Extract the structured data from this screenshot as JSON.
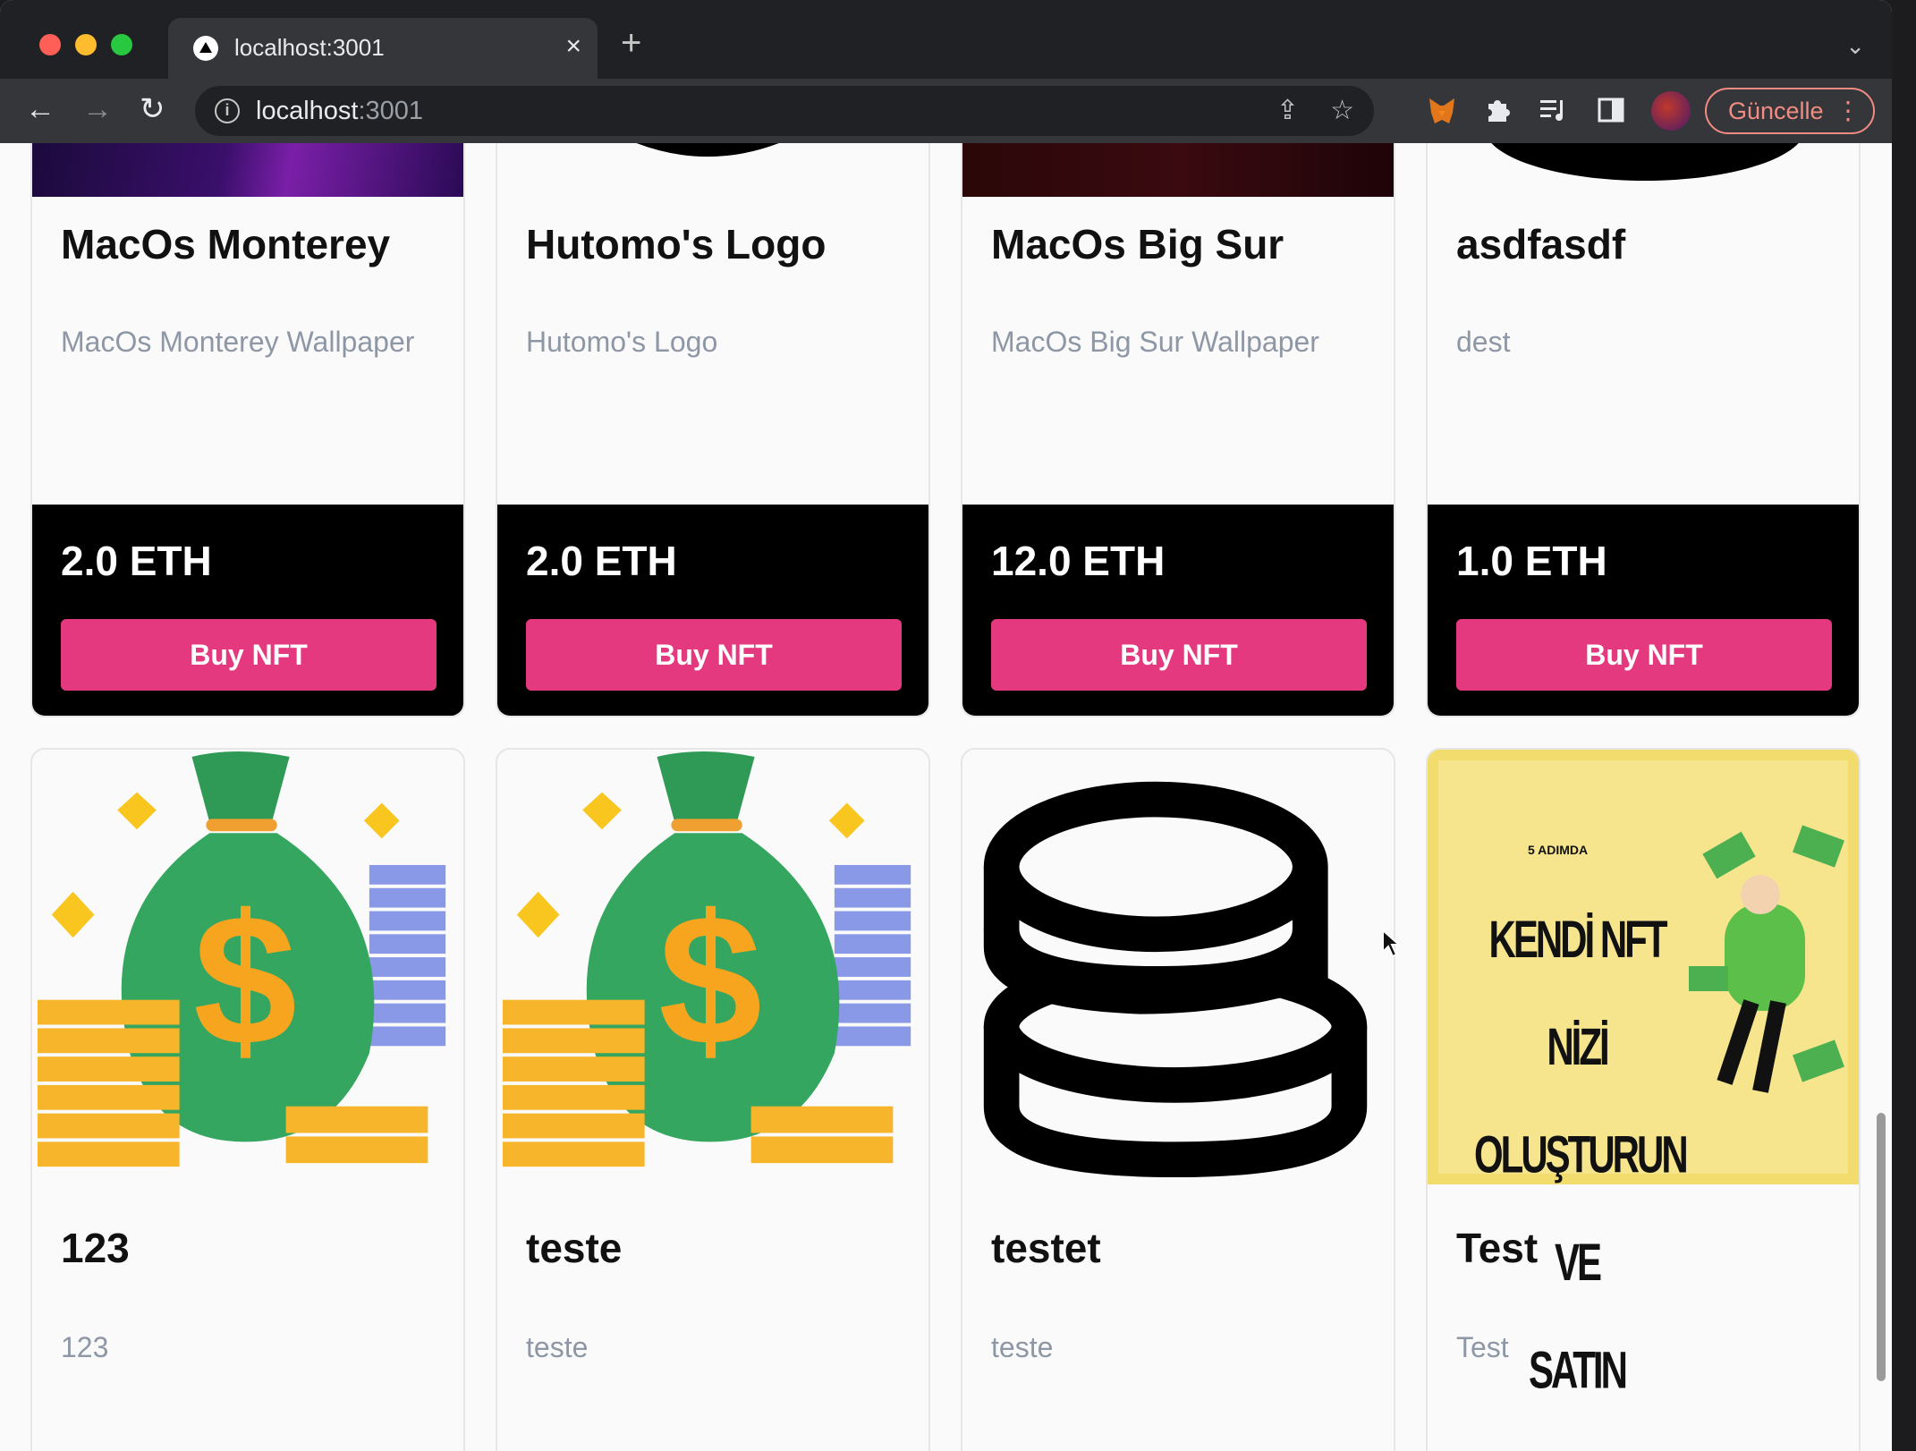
{
  "browser": {
    "tab_title": "localhost:3001",
    "tab_close": "×",
    "new_tab": "+",
    "tab_menu": "⌄",
    "url_host": "localhost",
    "url_port": ":3001",
    "back": "←",
    "forward": "→",
    "reload": "↻",
    "share_icon": "⇪",
    "bookmark_icon": "☆",
    "update_label": "Güncelle",
    "update_menu": "⋮"
  },
  "cards_top": [
    {
      "name": "MacOs Monterey",
      "description": "MacOs Monterey Wallpaper",
      "price": "2.0 ETH",
      "button": "Buy NFT"
    },
    {
      "name": "Hutomo's Logo",
      "description": "Hutomo's Logo",
      "price": "2.0 ETH",
      "button": "Buy NFT"
    },
    {
      "name": "MacOs Big Sur",
      "description": "MacOs Big Sur Wallpaper",
      "price": "12.0 ETH",
      "button": "Buy NFT"
    },
    {
      "name": "asdfasdf",
      "description": "dest",
      "price": "1.0 ETH",
      "button": "Buy NFT"
    }
  ],
  "cards_bottom": [
    {
      "name": "123",
      "description": "123"
    },
    {
      "name": "teste",
      "description": "teste"
    },
    {
      "name": "testet",
      "description": "teste"
    },
    {
      "name": "Test",
      "description": "Test",
      "image_text": [
        "5 ADIMDA",
        "KENDİ NFT NİZİ",
        "OLUŞTURUN VE",
        "SATIN"
      ]
    }
  ],
  "colors": {
    "buy_button": "#e5397f",
    "footer": "#000000",
    "description": "#8e97a5"
  }
}
